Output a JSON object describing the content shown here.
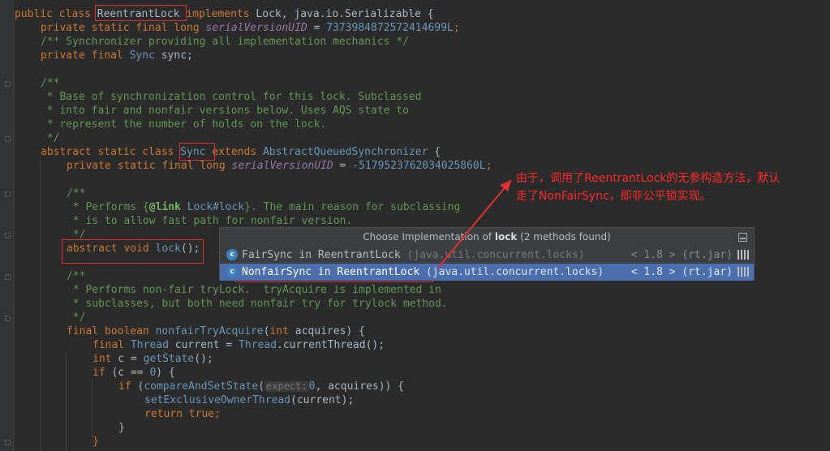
{
  "code": {
    "l0": {
      "a": "public class ",
      "b": "ReentrantLock",
      "c": " implements ",
      "d": "Lock",
      ".e": "",
      "e": ", java.io.Serializable {"
    },
    "l1": {
      "a": "private static final long ",
      "b": "serialVersionUID",
      "c": " = ",
      "d": "7373984872572414699L",
      "e": ";"
    },
    "l2": {
      "a": "/** Synchronizer providing all implementation mechanics */"
    },
    "l3": {
      "a": "private final ",
      "b": "Sync",
      "c": " sync;"
    },
    "l5": {
      "a": "/**"
    },
    "l6": {
      "a": " * Base of synchronization control for this lock. Subclassed"
    },
    "l7": {
      "a": " * into fair and nonfair versions below. Uses AQS state to"
    },
    "l8": {
      "a": " * represent the number of holds on the lock."
    },
    "l9": {
      "a": " */"
    },
    "l10": {
      "a": "abstract static class ",
      "b": "Sync",
      "c": " extends ",
      "d": "AbstractQueuedSynchronizer",
      "e": " {"
    },
    "l11": {
      "a": "private static final long ",
      "b": "serialVersionUID",
      "c": " = ",
      "d": "-5179523762034025860L",
      "e": ";"
    },
    "l13": {
      "a": "/**"
    },
    "l14": {
      "a": " * Performs {",
      "b": "@link",
      "c": " Lock#lock",
      "d": "}. The main reason for subclassing"
    },
    "l15": {
      "a": " * is to allow fast path for nonfair version."
    },
    "l16": {
      "a": " */"
    },
    "l17": {
      "a": "abstract void ",
      "b": "lock",
      "c": "();"
    },
    "l19": {
      "a": "/**"
    },
    "l20": {
      "a": " * Performs non-fair tryLock.  tryAcquire is implemented in"
    },
    "l21": {
      "a": " * subclasses, but both need nonfair try for trylock method."
    },
    "l22": {
      "a": " */"
    },
    "l23": {
      "a": "final boolean ",
      "b": "nonfairTryAcquire",
      "c": "(",
      "d": "int",
      " e": "",
      "e": " acquires) {"
    },
    "l24": {
      "a": "final ",
      "b": "Thread",
      "c": " current = ",
      "d": "Thread",
      ".e": "",
      "e": ".currentThread();"
    },
    "l25": {
      "a": "int",
      " b": "",
      "b": " c = ",
      "c": "getState",
      "d": "();"
    },
    "l26": {
      "a": "if",
      " b": "",
      "b": " (c == ",
      "c": "0",
      "d": ") {"
    },
    "l27": {
      "a": "if",
      " b": "",
      "b": " (",
      "c": "compareAndSetState",
      "d": "(",
      "e": "expect:",
      "f": "0",
      ".g": "",
      "g": ", acquires)) {"
    },
    "l28": {
      "a": "setExclusiveOwnerThread",
      "b": "(current);"
    },
    "l29": {
      "a": "return ",
      "b": "true",
      "c": ";"
    },
    "l30": {
      "a": "}"
    },
    "l31": {
      "a": "}"
    }
  },
  "popup": {
    "title_pre": "Choose Implementation of ",
    "title_bold": "lock",
    "title_post": " (2 methods found)",
    "items": [
      {
        "icon": "c",
        "name": "FairSync in ReentrantLock",
        "pkg": " (java.util.concurrent.locks)",
        "ver": "< 1.8 > (rt.jar)"
      },
      {
        "icon": "c",
        "name": "NonfairSync in ReentrantLock",
        "pkg": " (java.util.concurrent.locks)",
        "ver": "< 1.8 > (rt.jar)"
      }
    ]
  },
  "annotation": {
    "line1": "由于，调用了ReentrantLock的无参构造方法，默认",
    "line2": "走了NonFairSync，即非公平锁实现。",
    "color": "#ff2a2a"
  }
}
